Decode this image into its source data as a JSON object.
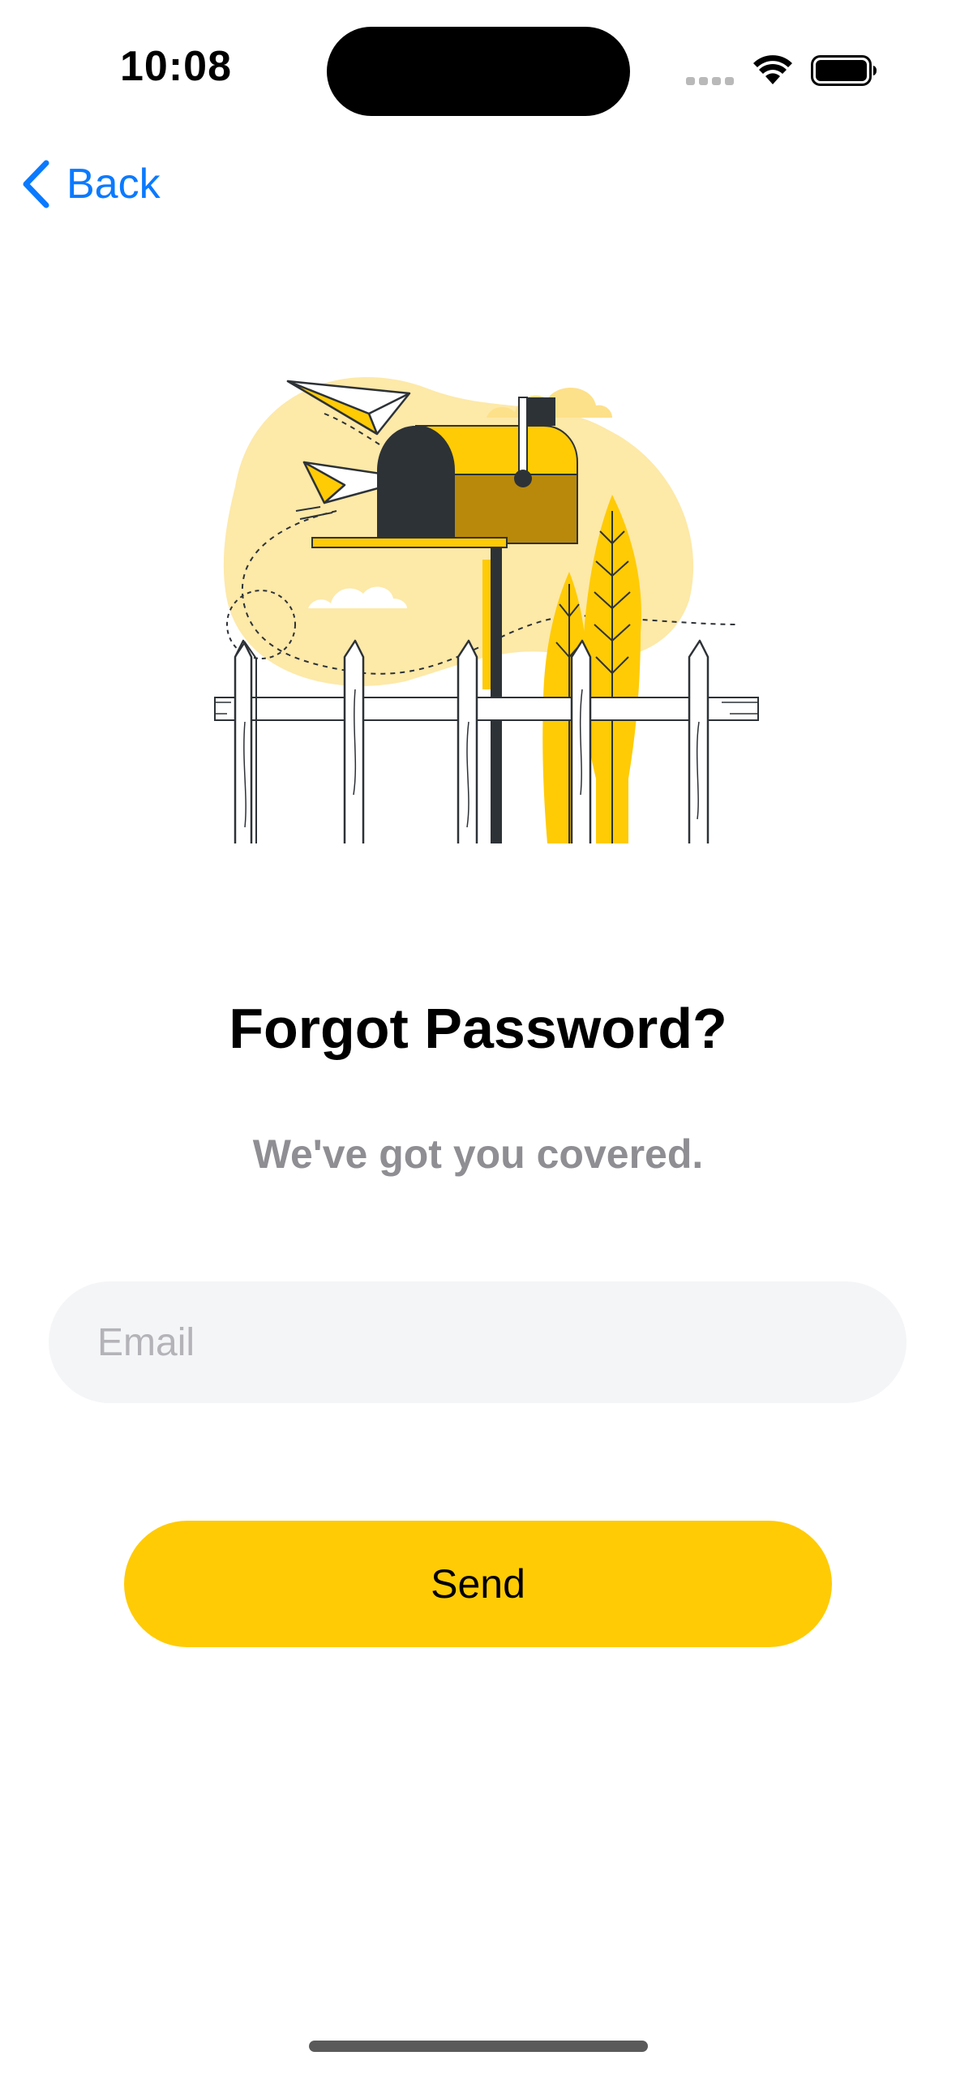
{
  "status_bar": {
    "time": "10:08",
    "icons": [
      "cellular-signal-icon",
      "wifi-icon",
      "battery-icon"
    ]
  },
  "nav": {
    "back_label": "Back"
  },
  "illustration": {
    "subject": "mailbox-with-paper-planes-illustration"
  },
  "content": {
    "title": "Forgot Password?",
    "subtitle": "We've got you covered."
  },
  "form": {
    "email_placeholder": "Email",
    "email_value": "",
    "send_label": "Send"
  },
  "colors": {
    "accent": "#ffcb05",
    "link_blue": "#0a7aff",
    "subtitle_gray": "#8e8e93",
    "field_bg": "#f4f5f7",
    "illustration_light": "#fde9a8",
    "illustration_dark": "#2d3237",
    "illustration_olive": "#b8890a"
  }
}
